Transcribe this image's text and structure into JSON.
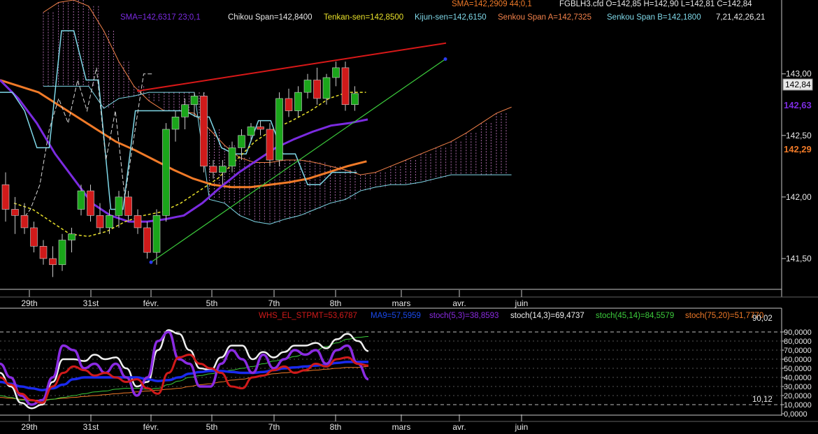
{
  "header": {
    "sma_line": "SMA=142,2909  44;0,1",
    "ohlc": "FGBLH3.cfd O=142,85 H=142,90 L=142,81 C=142,84",
    "sma2": "SMA=142,6317  23;0,1",
    "chikou": "Chikou Span=142,8400",
    "tenkan": "Tenkan-sen=142,8500",
    "kijun": "Kijun-sen=142,6150",
    "senkou_a": "Senkou Span A=142,7325",
    "senkou_b": "Senkou Span B=142,1800",
    "ichimoku_params": "7,21,42,26,21"
  },
  "colors": {
    "up": "#1aa51a",
    "down": "#d01a1a",
    "sma_fast": "#7b2be0",
    "sma_slow": "#f07a28",
    "tenkan": "#e8e02a",
    "kijun": "#7fd8e8",
    "senkou_a": "#f0804a",
    "senkou_b": "#7fd8e8",
    "trend_red": "#d81818",
    "trend_green": "#3ccc3c"
  },
  "price_labels": {
    "current": "142,84",
    "sma_fast": "142,63",
    "sma_slow": "142,29"
  },
  "time_axis": [
    "29th",
    "31st",
    "févr.",
    "5th",
    "7th",
    "8th",
    "mars",
    "avr.",
    "juin"
  ],
  "indicator_header": {
    "whs": "WHS_EL_STPMT=53,6787",
    "ma9": "MA9=57,5959",
    "stoch_5": "stoch(5,3)=38,8593",
    "stoch_14": "stoch(14,3)=69,4737",
    "stoch_45": "stoch(45,14)=84,5579",
    "stoch_75": "stoch(75,20)=51,7770"
  },
  "indicator_levels": {
    "upper": "90,02",
    "lower": "10,12"
  },
  "chart_data": [
    {
      "type": "candlestick",
      "title": "FGBLH3.cfd",
      "y_ticks": [
        "143,00",
        "142,50",
        "142,00",
        "141,50"
      ],
      "ylim": [
        141.25,
        143.6
      ],
      "candles": [
        [
          142.1,
          142.2,
          141.8,
          141.9
        ],
        [
          141.9,
          142.0,
          141.7,
          141.85
        ],
        [
          141.85,
          141.95,
          141.7,
          141.75
        ],
        [
          141.75,
          141.8,
          141.55,
          141.6
        ],
        [
          141.6,
          141.65,
          141.45,
          141.5
        ],
        [
          141.5,
          141.6,
          141.35,
          141.45
        ],
        [
          141.45,
          141.7,
          141.4,
          141.65
        ],
        [
          141.65,
          141.75,
          141.55,
          141.7
        ],
        [
          141.9,
          142.1,
          141.85,
          142.05
        ],
        [
          142.05,
          142.1,
          141.8,
          141.85
        ],
        [
          141.85,
          141.95,
          141.7,
          141.75
        ],
        [
          141.75,
          141.9,
          141.7,
          141.85
        ],
        [
          141.85,
          142.05,
          141.75,
          142.0
        ],
        [
          142.0,
          142.05,
          141.8,
          141.85
        ],
        [
          141.85,
          141.9,
          141.7,
          141.75
        ],
        [
          141.75,
          141.8,
          141.5,
          141.55
        ],
        [
          141.55,
          141.9,
          141.45,
          141.85
        ],
        [
          141.85,
          142.6,
          141.8,
          142.55
        ],
        [
          142.55,
          142.7,
          142.45,
          142.65
        ],
        [
          142.65,
          142.8,
          142.55,
          142.75
        ],
        [
          142.75,
          142.85,
          142.65,
          142.82
        ],
        [
          142.82,
          142.85,
          142.2,
          142.25
        ],
        [
          142.25,
          142.3,
          142.15,
          142.2
        ],
        [
          142.2,
          142.3,
          142.1,
          142.25
        ],
        [
          142.25,
          142.45,
          142.2,
          142.4
        ],
        [
          142.4,
          142.55,
          142.3,
          142.5
        ],
        [
          142.5,
          142.6,
          142.45,
          142.57
        ],
        [
          142.57,
          142.62,
          142.5,
          142.55
        ],
        [
          142.55,
          142.6,
          142.25,
          142.3
        ],
        [
          142.3,
          142.85,
          142.25,
          142.8
        ],
        [
          142.8,
          142.88,
          142.65,
          142.7
        ],
        [
          142.7,
          142.9,
          142.65,
          142.85
        ],
        [
          142.85,
          143.0,
          142.8,
          142.95
        ],
        [
          142.95,
          143.05,
          142.75,
          142.8
        ],
        [
          142.8,
          143.0,
          142.75,
          142.97
        ],
        [
          142.97,
          143.1,
          142.9,
          143.05
        ],
        [
          143.05,
          143.1,
          142.7,
          142.75
        ],
        [
          142.75,
          142.9,
          142.7,
          142.84
        ]
      ],
      "sma_fast": [
        142.95,
        142.8,
        142.6,
        142.35,
        142.15,
        141.95,
        141.85,
        141.8,
        141.8,
        141.82,
        141.85,
        141.95,
        142.08,
        142.2,
        142.3,
        142.4,
        142.47,
        142.53,
        142.58,
        142.6,
        142.63
      ],
      "sma_slow": [
        142.95,
        142.9,
        142.85,
        142.75,
        142.65,
        142.55,
        142.45,
        142.38,
        142.3,
        142.22,
        142.15,
        142.1,
        142.08,
        142.08,
        142.1,
        142.12,
        142.15,
        142.2,
        142.25,
        142.29
      ],
      "tenkan": [
        141.95,
        141.9,
        141.8,
        141.7,
        141.68,
        141.72,
        141.8,
        141.85,
        141.88,
        141.95,
        142.05,
        142.15,
        142.3,
        142.45,
        142.55,
        142.62,
        142.7,
        142.8,
        142.85,
        142.85
      ],
      "kijun": [
        142.85,
        142.85,
        142.7,
        142.4,
        142.4,
        143.35,
        143.35,
        142.95,
        142.95,
        141.9,
        141.9,
        142.7,
        142.7,
        142.7,
        142.7,
        142.7,
        142.65,
        142.65,
        142.4,
        142.35,
        142.35,
        142.62,
        142.62,
        142.35,
        142.35,
        142.1,
        142.1,
        142.2,
        142.2,
        142.2
      ]
    },
    {
      "type": "line",
      "title": "WHS_EL_STPMT",
      "y_ticks": [
        "90,0000",
        "80,0000",
        "70,0000",
        "60,0000",
        "50,0000",
        "40,0000",
        "30,0000",
        "20,0000",
        "10,0000",
        "0,0000"
      ],
      "ylim": [
        0,
        100
      ],
      "series": [
        {
          "name": "WHS_EL_STPMT",
          "color": "#d01a1a",
          "values": [
            40,
            32,
            22,
            15,
            12,
            30,
            45,
            52,
            48,
            42,
            45,
            40,
            35,
            38,
            28,
            22,
            45,
            62,
            65,
            55,
            50,
            45,
            30,
            28,
            40,
            42,
            48,
            52,
            45,
            48,
            55,
            52,
            60,
            62,
            55,
            53
          ]
        },
        {
          "name": "MA9",
          "color": "#1a2aee",
          "values": [
            35,
            33,
            30,
            28,
            26,
            28,
            32,
            38,
            40,
            40,
            40,
            40,
            40,
            40,
            38,
            36,
            37,
            40,
            44,
            46,
            47,
            47,
            46,
            45,
            45,
            46,
            48,
            50,
            51,
            52,
            53,
            54,
            56,
            57,
            57,
            57
          ]
        },
        {
          "name": "stoch(5,3)",
          "color": "#8a2be2",
          "values": [
            55,
            40,
            20,
            10,
            15,
            40,
            75,
            70,
            50,
            55,
            45,
            55,
            40,
            20,
            40,
            80,
            90,
            60,
            55,
            30,
            30,
            55,
            70,
            60,
            45,
            65,
            50,
            60,
            70,
            65,
            70,
            55,
            70,
            75,
            55,
            38
          ]
        },
        {
          "name": "stoch(14,3)",
          "color": "#f0f0f0",
          "values": [
            45,
            30,
            12,
            6,
            10,
            35,
            60,
            60,
            58,
            65,
            60,
            62,
            50,
            30,
            35,
            70,
            92,
            88,
            70,
            50,
            48,
            62,
            75,
            75,
            60,
            68,
            62,
            68,
            75,
            75,
            78,
            72,
            82,
            88,
            80,
            69
          ]
        },
        {
          "name": "stoch(45,14)",
          "color": "#3ccc3c",
          "values": [
            20,
            18,
            15,
            14,
            14,
            16,
            18,
            20,
            22,
            24,
            25,
            27,
            28,
            28,
            27,
            28,
            32,
            36,
            40,
            42,
            44,
            46,
            48,
            50,
            52,
            55,
            58,
            60,
            63,
            66,
            70,
            74,
            78,
            82,
            84,
            85
          ]
        },
        {
          "name": "stoch(75,20)",
          "color": "#f07a28",
          "values": [
            18,
            17,
            16,
            15,
            15,
            16,
            17,
            18,
            19,
            20,
            21,
            22,
            23,
            24,
            25,
            26,
            27,
            28,
            30,
            32,
            33,
            35,
            37,
            38,
            40,
            42,
            44,
            45,
            46,
            47,
            48,
            49,
            50,
            51,
            51,
            52
          ]
        }
      ]
    }
  ]
}
